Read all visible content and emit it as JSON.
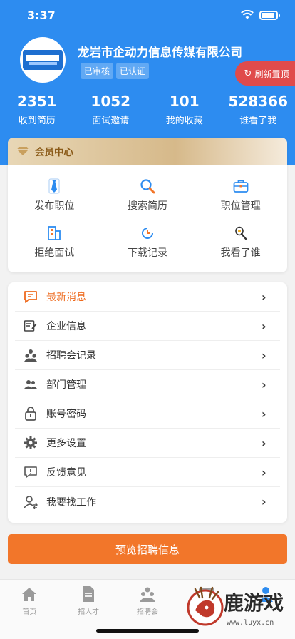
{
  "status_bar": {
    "time": "3:37"
  },
  "company": {
    "name": "龙岩市企动力信息传媒有限公司",
    "badges": [
      "已审核",
      "已认证"
    ]
  },
  "refresh_button": {
    "label": "刷新置顶"
  },
  "stats": [
    {
      "value": "2351",
      "label": "收到简历"
    },
    {
      "value": "1052",
      "label": "面试邀请"
    },
    {
      "value": "101",
      "label": "我的收藏"
    },
    {
      "value": "528366",
      "label": "谁看了我"
    }
  ],
  "member_center": {
    "title": "会员中心",
    "items": [
      {
        "label": "发布职位",
        "icon": "tie-icon"
      },
      {
        "label": "搜索简历",
        "icon": "search-icon"
      },
      {
        "label": "职位管理",
        "icon": "briefcase-icon"
      },
      {
        "label": "拒绝面试",
        "icon": "building-icon"
      },
      {
        "label": "下载记录",
        "icon": "clock-icon"
      },
      {
        "label": "我看了谁",
        "icon": "eye-icon"
      }
    ]
  },
  "menu": [
    {
      "label": "最新消息",
      "icon": "message-icon",
      "active": true
    },
    {
      "label": "企业信息",
      "icon": "edit-doc-icon"
    },
    {
      "label": "招聘会记录",
      "icon": "group-icon"
    },
    {
      "label": "部门管理",
      "icon": "users-icon"
    },
    {
      "label": "账号密码",
      "icon": "lock-icon"
    },
    {
      "label": "更多设置",
      "icon": "gear-icon"
    },
    {
      "label": "反馈意见",
      "icon": "feedback-icon"
    },
    {
      "label": "我要找工作",
      "icon": "user-switch-icon"
    }
  ],
  "preview_button": {
    "label": "预览招聘信息"
  },
  "tabs": [
    {
      "label": "首页",
      "icon": "home-icon"
    },
    {
      "label": "招人才",
      "icon": "document-icon"
    },
    {
      "label": "招聘会",
      "icon": "group-icon"
    },
    {
      "label": "",
      "icon": "chat-icon"
    },
    {
      "label": "",
      "icon": "user-icon"
    }
  ],
  "watermark": {
    "text": "鹿游戏",
    "url": "www.luyx.cn"
  },
  "colors": {
    "primary": "#2d8cf0",
    "accent": "#f2762a",
    "refresh": "#e04b4b",
    "member_gold": "#d6b98a",
    "active_menu": "#ee6a1d"
  }
}
